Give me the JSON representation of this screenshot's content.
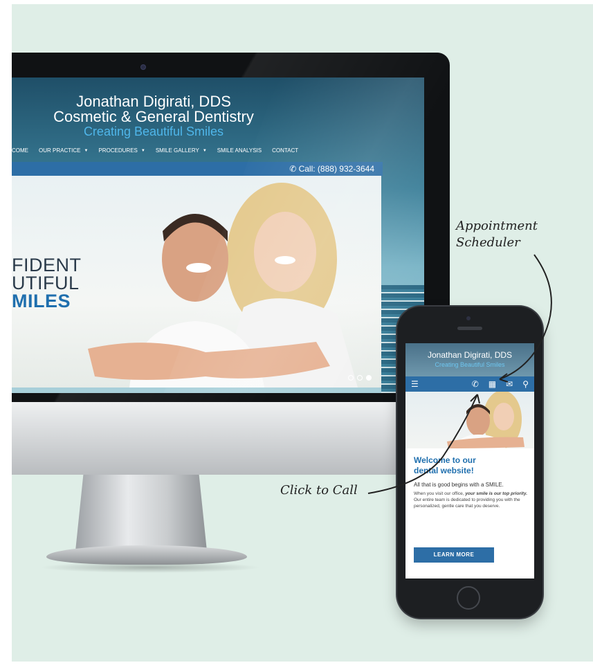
{
  "desktop": {
    "title_line1": "Jonathan Digirati, DDS",
    "title_line2": "Cosmetic & General Dentistry",
    "tagline": "Creating Beautiful Smiles",
    "nav": [
      "COME",
      "OUR PRACTICE",
      "PROCEDURES",
      "SMILE GALLERY",
      "SMILE ANALYSIS",
      "CONTACT"
    ],
    "call": "Call: (888) 932-3644",
    "hero_lines": [
      "FIDENT",
      "UTIFUL",
      "MILES"
    ]
  },
  "mobile": {
    "title": "Jonathan Digirati, DDS",
    "tagline": "Creating Beautiful Smiles",
    "heading_line1": "Welcome to our",
    "heading_line2": "dental website!",
    "lead": "All that is good begins with a SMILE.",
    "body_prefix": "When you visit our office,",
    "body_emph": "your smile is our top priority.",
    "body_suffix": "Our entire team is dedicated to providing you with the personalized, gentle care that you deserve.",
    "button": "LEARN MORE"
  },
  "callouts": {
    "appointment_line1": "Appointment",
    "appointment_line2": "Scheduler",
    "call": "Click to Call"
  },
  "colors": {
    "background": "#dfeee7",
    "brand_blue": "#2d6ea6",
    "tagline_blue": "#4fb6ea"
  },
  "icons": [
    "hamburger-icon",
    "phone-icon",
    "calendar-icon",
    "mail-icon",
    "map-pin-icon"
  ]
}
